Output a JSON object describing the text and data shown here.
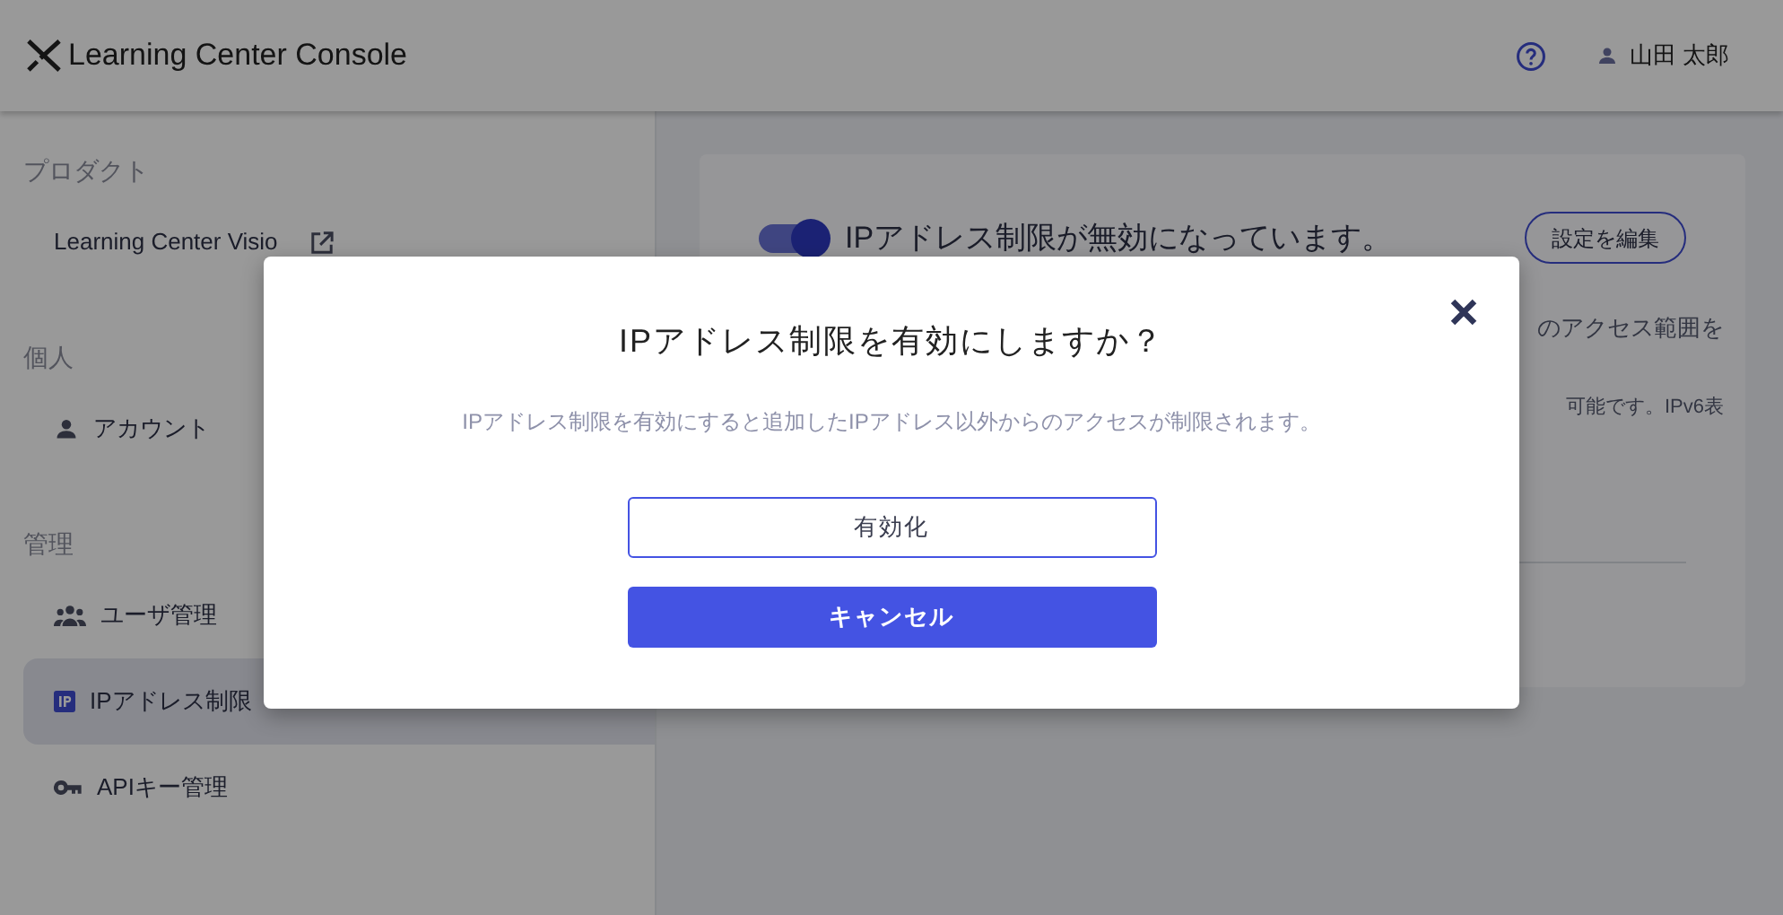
{
  "header": {
    "title": "Learning Center Console",
    "user": "山田 太郎"
  },
  "sidebar": {
    "sections": [
      {
        "heading": "プロダクト",
        "items": [
          {
            "label": "Learning Center Visio",
            "selected": false
          }
        ]
      },
      {
        "heading": "個人",
        "items": [
          {
            "label": "アカウント",
            "selected": false
          }
        ]
      },
      {
        "heading": "管理",
        "items": [
          {
            "label": "ユーザ管理",
            "selected": false
          },
          {
            "label": "IPアドレス制限",
            "selected": true
          },
          {
            "label": "APIキー管理",
            "selected": false
          }
        ]
      }
    ]
  },
  "card": {
    "toggle": {
      "on": true
    },
    "status": "IPアドレス制限が無効になっています。",
    "edit_button": "設定を編集",
    "line_1": "のアクセス範囲を",
    "line_2": "可能です。IPv6表"
  },
  "dialog": {
    "title": "IPアドレス制限を有効にしますか？",
    "message": "IPアドレス制限を有効にすると追加したIPアドレス以外からのアクセスが制限されます。",
    "buttons": [
      {
        "label": "有効化",
        "kind": "outline"
      },
      {
        "label": "キャンセル",
        "kind": "primary"
      }
    ]
  }
}
